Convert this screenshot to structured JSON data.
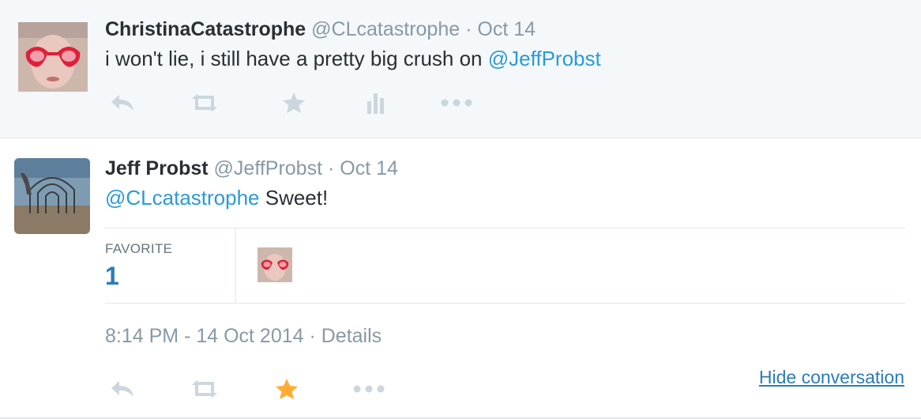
{
  "tweets": [
    {
      "fullname": "ChristinaCatastrophe",
      "username": "@CLcatastrophe",
      "separator": "·",
      "date": "Oct 14",
      "text": "i won't lie, i still have a pretty big crush on ",
      "mention": "@JeffProbst",
      "actions": [
        "reply-icon",
        "retweet-icon",
        "favorite-icon",
        "analytics-icon",
        "more-icon"
      ]
    },
    {
      "fullname": "Jeff Probst",
      "username": "@JeffProbst",
      "separator": "·",
      "date": "Oct 14",
      "mention": "@CLcatastrophe",
      "text": " Sweet!",
      "stats": {
        "label": "FAVORITE",
        "value": "1"
      },
      "timestamp": "8:14 PM - 14 Oct 2014",
      "details_sep": " · ",
      "details": "Details",
      "hide_conversation": "Hide conversation",
      "actions": [
        "reply-icon",
        "retweet-icon",
        "favorite-icon",
        "more-icon"
      ]
    }
  ],
  "colors": {
    "link": "#2b9ad8",
    "meta": "#8899a6",
    "action_icon": "#ccd6dd",
    "favorited": "#ffac33",
    "stats_value": "#2b7bb9"
  }
}
